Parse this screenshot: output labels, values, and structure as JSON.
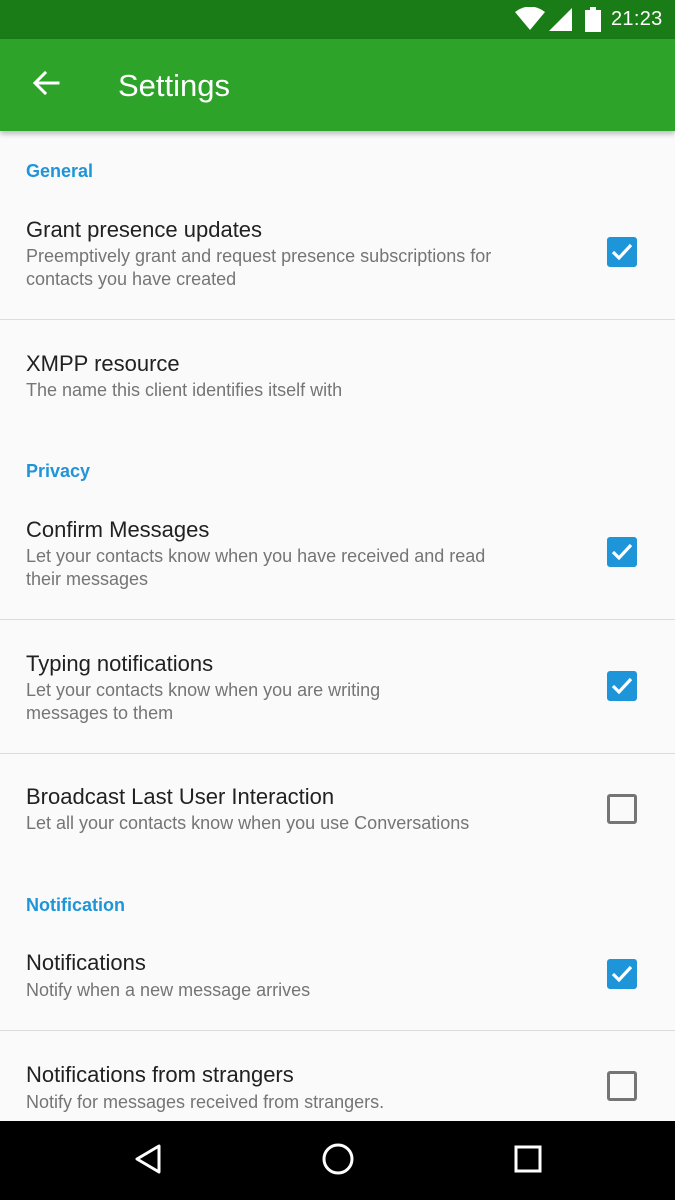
{
  "status_bar": {
    "time": "21:23",
    "icons": [
      "wifi-icon",
      "signal-icon",
      "battery-icon"
    ]
  },
  "app_bar": {
    "title": "Settings",
    "back_icon": "arrow-back-icon",
    "color": "#2ea32a"
  },
  "sections": {
    "general": "General",
    "privacy": "Privacy",
    "notification": "Notification"
  },
  "prefs": {
    "grant_presence": {
      "title": "Grant presence updates",
      "summary": "Preemptively grant and request presence subscriptions for contacts you have created",
      "checked": true
    },
    "xmpp_resource": {
      "title": "XMPP resource",
      "summary": "The name this client identifies itself with"
    },
    "confirm_messages": {
      "title": "Confirm Messages",
      "summary": "Let your contacts know when you have received and read their messages",
      "checked": true
    },
    "typing_notifications": {
      "title": "Typing notifications",
      "summary": "Let your contacts know when you are writing messages to them",
      "checked": true
    },
    "broadcast_last_interaction": {
      "title": "Broadcast Last User Interaction",
      "summary": "Let all your contacts know when you use Conversations",
      "checked": false
    },
    "notifications": {
      "title": "Notifications",
      "summary": "Notify when a new message arrives",
      "checked": true
    },
    "notifications_strangers": {
      "title": "Notifications from strangers",
      "summary": "Notify for messages received from strangers.",
      "checked": false
    }
  },
  "colors": {
    "accent": "#1e95d9",
    "status_bar": "#1a7c16"
  },
  "nav_bar": {
    "buttons": [
      "back-triangle-icon",
      "home-circle-icon",
      "recents-square-icon"
    ]
  }
}
